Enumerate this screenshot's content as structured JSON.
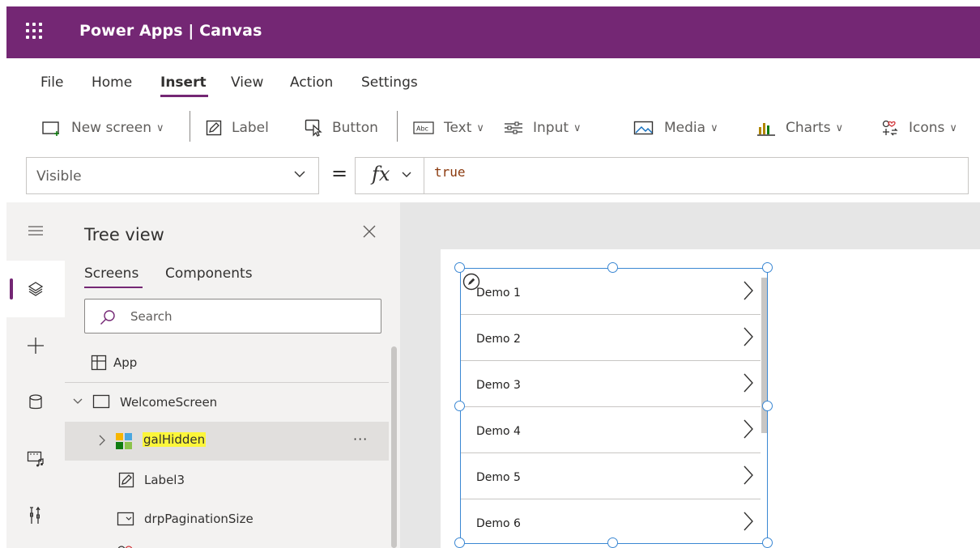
{
  "app": {
    "title": "Power Apps  |  Canvas"
  },
  "menu": {
    "tabs": [
      "File",
      "Home",
      "Insert",
      "View",
      "Action",
      "Settings"
    ],
    "active": "Insert"
  },
  "toolbar": {
    "new_screen": "New screen",
    "label": "Label",
    "button": "Button",
    "text": "Text",
    "input": "Input",
    "media": "Media",
    "charts": "Charts",
    "icons": "Icons"
  },
  "formula": {
    "property": "Visible",
    "equals": "=",
    "fx": "fx",
    "value": "true"
  },
  "rail": {
    "icons": [
      "hamburger-icon",
      "layers-icon",
      "plus-icon",
      "database-icon",
      "media-icon",
      "tools-icon"
    ],
    "active": "layers-icon"
  },
  "treeview": {
    "title": "Tree view",
    "tabs": [
      "Screens",
      "Components"
    ],
    "active_tab": "Screens",
    "search_placeholder": "Search",
    "items": {
      "app": "App",
      "welcome": "WelcomeScreen",
      "gallery": "galHidden",
      "label3": "Label3",
      "dropdown": "drpPaginationSize"
    },
    "more": "···"
  },
  "gallery": {
    "items": [
      "Demo 1",
      "Demo 2",
      "Demo 3",
      "Demo 4",
      "Demo 5",
      "Demo 6"
    ]
  },
  "colors": {
    "brand": "#742774",
    "selection": "#3a87d3",
    "highlight": "#fcf63b"
  }
}
